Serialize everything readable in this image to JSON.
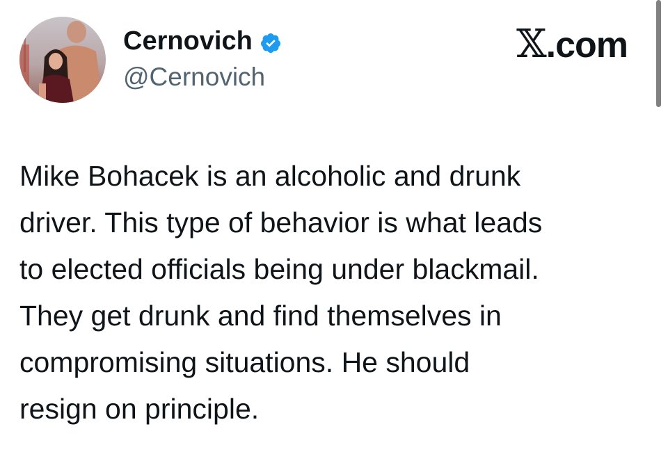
{
  "author": {
    "display_name": "Cernovich",
    "handle": "@Cernovich",
    "verified": true,
    "verified_color": "#1d9bf0"
  },
  "brand": {
    "label": "X.com",
    "x_char": "𝕏",
    "suffix": ".com"
  },
  "tweet": {
    "text": "Mike Bohacek is an alcoholic and drunk\ndriver. This type of behavior is what leads\nto elected officials being under blackmail.\nThey get drunk and find themselves in\ncompromising situations. He should\nresign on principle."
  },
  "icons": {
    "avatar": "profile-photo",
    "verified": "verified-badge-icon"
  },
  "colors": {
    "text": "#0f1419",
    "secondary_text": "#536471",
    "background": "#ffffff"
  }
}
